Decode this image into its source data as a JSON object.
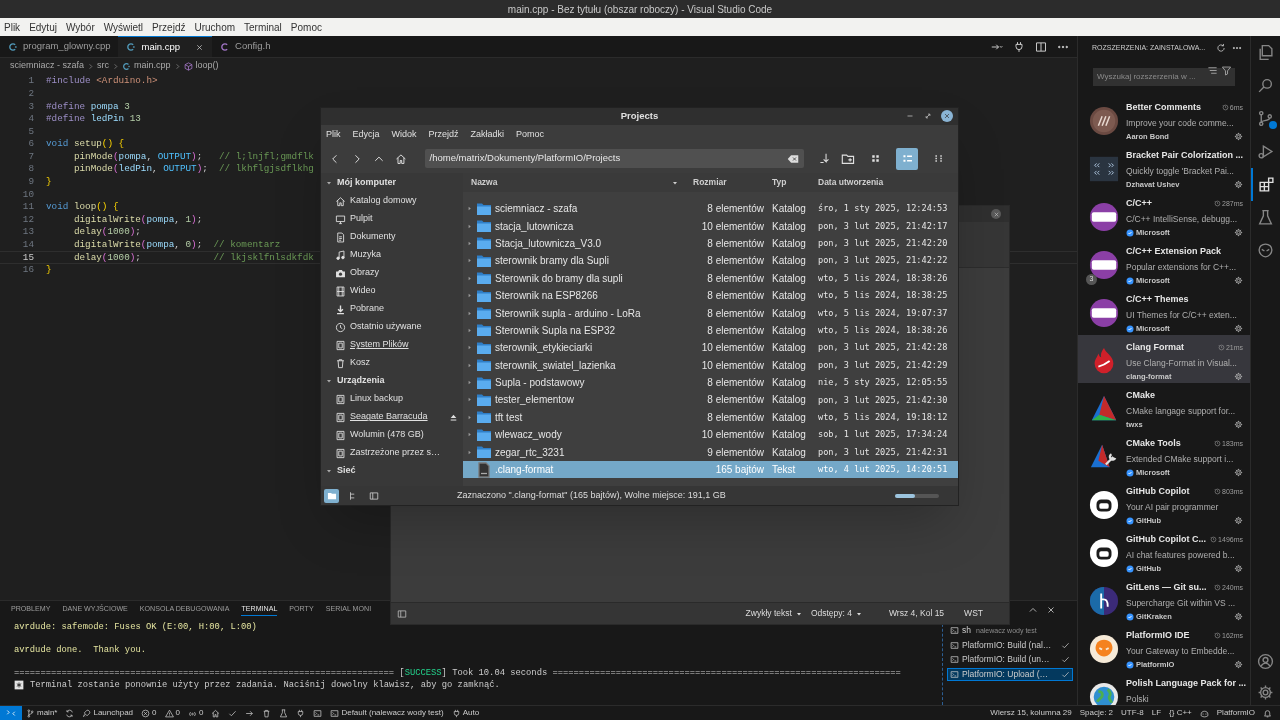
{
  "window": {
    "title": "main.cpp - Bez tytułu (obszar roboczy) - Visual Studio Code"
  },
  "menu": [
    "Plik",
    "Edytuj",
    "Wybór",
    "Wyświetl",
    "Przejdź",
    "Uruchom",
    "Terminal",
    "Pomoc"
  ],
  "editor": {
    "tabs": [
      {
        "label": "program_glowny.cpp",
        "kind": "cpp",
        "selected": false
      },
      {
        "label": "main.cpp",
        "kind": "cpp",
        "selected": true
      },
      {
        "label": "Config.h",
        "kind": "h",
        "selected": false
      }
    ],
    "breadcrumbs": [
      {
        "label": "sciemniacz - szafa",
        "kind": "folder"
      },
      {
        "label": "src",
        "kind": "folder"
      },
      {
        "label": "main.cpp",
        "kind": "cpp"
      },
      {
        "label": "loop()",
        "kind": "function"
      }
    ],
    "lines": [
      {
        "number": "1",
        "current": false,
        "tokens": [
          {
            "text": "#include ",
            "kind": "pre"
          },
          {
            "text": "<Arduino.h>",
            "kind": "str"
          }
        ]
      },
      {
        "number": "2",
        "current": false
      },
      {
        "number": "3",
        "current": false,
        "tokens": [
          {
            "text": "#define ",
            "kind": "pre"
          },
          {
            "text": "pompa",
            "kind": "macro"
          },
          {
            "text": " 3",
            "kind": "num"
          }
        ]
      },
      {
        "number": "4",
        "current": false,
        "tokens": [
          {
            "text": "#define ",
            "kind": "pre"
          },
          {
            "text": "ledPin",
            "kind": "macro"
          },
          {
            "text": " 13",
            "kind": "num"
          }
        ]
      },
      {
        "number": "5",
        "current": false
      },
      {
        "number": "6",
        "current": false,
        "tokens": [
          {
            "text": "void",
            "kind": "kw"
          },
          {
            "text": " setup",
            "kind": "fn"
          },
          {
            "text": "() {",
            "kind": "br1"
          }
        ]
      },
      {
        "number": "7",
        "current": false,
        "tokens": [
          {
            "text": "     pinMode",
            "kind": "fn"
          },
          {
            "text": "(",
            "kind": "br2"
          },
          {
            "text": "pompa",
            "kind": "var"
          },
          {
            "text": ", ",
            "kind": "plain"
          },
          {
            "text": "OUTPUT",
            "kind": "const"
          },
          {
            "text": ")",
            "kind": "br2"
          },
          {
            "text": ";   ",
            "kind": "plain"
          },
          {
            "text": "// l;lnjfl;gmdflk",
            "kind": "cmt"
          }
        ]
      },
      {
        "number": "8",
        "current": false,
        "tokens": [
          {
            "text": "     pinMode",
            "kind": "fn"
          },
          {
            "text": "(",
            "kind": "br2"
          },
          {
            "text": "ledPin",
            "kind": "var"
          },
          {
            "text": ", ",
            "kind": "plain"
          },
          {
            "text": "OUTPUT",
            "kind": "const"
          },
          {
            "text": ")",
            "kind": "br2"
          },
          {
            "text": ";  ",
            "kind": "plain"
          },
          {
            "text": "// lkhflgjsdflkhg",
            "kind": "cmt"
          }
        ]
      },
      {
        "number": "9",
        "current": false,
        "tokens": [
          {
            "text": "}",
            "kind": "br1"
          }
        ]
      },
      {
        "number": "10",
        "current": false
      },
      {
        "number": "11",
        "current": false,
        "tokens": [
          {
            "text": "void",
            "kind": "kw"
          },
          {
            "text": " loop",
            "kind": "fn"
          },
          {
            "text": "() {",
            "kind": "br1"
          }
        ]
      },
      {
        "number": "12",
        "current": false,
        "tokens": [
          {
            "text": "     digitalWrite",
            "kind": "fn"
          },
          {
            "text": "(",
            "kind": "br2"
          },
          {
            "text": "pompa",
            "kind": "var"
          },
          {
            "text": ", ",
            "kind": "plain"
          },
          {
            "text": "1",
            "kind": "num"
          },
          {
            "text": ")",
            "kind": "br2"
          },
          {
            "text": ";",
            "kind": "plain"
          }
        ]
      },
      {
        "number": "13",
        "current": false,
        "tokens": [
          {
            "text": "     delay",
            "kind": "fn"
          },
          {
            "text": "(",
            "kind": "br2"
          },
          {
            "text": "1000",
            "kind": "num"
          },
          {
            "text": ")",
            "kind": "br2"
          },
          {
            "text": ";",
            "kind": "plain"
          }
        ]
      },
      {
        "number": "14",
        "current": false,
        "tokens": [
          {
            "text": "     digitalWrite",
            "kind": "fn"
          },
          {
            "text": "(",
            "kind": "br2"
          },
          {
            "text": "pompa",
            "kind": "var"
          },
          {
            "text": ", ",
            "kind": "plain"
          },
          {
            "text": "0",
            "kind": "num"
          },
          {
            "text": ")",
            "kind": "br2"
          },
          {
            "text": ";  ",
            "kind": "plain"
          },
          {
            "text": "// komentarz",
            "kind": "cmt"
          }
        ]
      },
      {
        "number": "15",
        "current": true,
        "tokens": [
          {
            "text": "     delay",
            "kind": "fn"
          },
          {
            "text": "(",
            "kind": "br2"
          },
          {
            "text": "1000",
            "kind": "num"
          },
          {
            "text": ")",
            "kind": "br2"
          },
          {
            "text": ";             ",
            "kind": "plain"
          },
          {
            "text": "// lkjsklfnlsdkfdk",
            "kind": "cmt"
          }
        ]
      },
      {
        "number": "16",
        "current": false,
        "tokens": [
          {
            "text": "}",
            "kind": "br1"
          }
        ]
      }
    ]
  },
  "panel": {
    "tabs": [
      {
        "label": "PROBLEMY",
        "selected": false
      },
      {
        "label": "DANE WYJŚCIOWE",
        "selected": false
      },
      {
        "label": "KONSOLA DEBUGOWANIA",
        "selected": false
      },
      {
        "label": "TERMINAL",
        "selected": true
      },
      {
        "label": "PORTY",
        "selected": false
      },
      {
        "label": "SERIAL MONI",
        "selected": false
      }
    ],
    "terminal": [
      {
        "kind": "text",
        "tokens": [
          {
            "text": "avrdude: safemode: Fuses OK (E:00, H:00, L:00)",
            "kind": "warn"
          }
        ]
      },
      {
        "kind": "blank"
      },
      {
        "kind": "text",
        "tokens": [
          {
            "text": "avrdude done.  Thank you.",
            "kind": "warn"
          }
        ]
      },
      {
        "kind": "blank"
      },
      {
        "kind": "text",
        "tokens": [
          {
            "text": "======================================================================== [",
            "kind": "plain"
          },
          {
            "text": "SUCCESS",
            "kind": "success"
          },
          {
            "text": "] Took 10.04 seconds ==================================================================",
            "kind": "plain"
          }
        ]
      },
      {
        "kind": "notice",
        "tokens": [
          {
            "text": "Terminal zostanie ponownie użyty przez zadania. Naciśnij dowolny klawisz, aby go zamknąć.",
            "kind": "plain"
          }
        ]
      }
    ],
    "tasks": [
      {
        "kind": "shell",
        "label": "sh",
        "detail": "nalewacz wody test",
        "done": false,
        "selected": false
      },
      {
        "kind": "task",
        "label": "PlatformIO: Build (nal…",
        "done": true,
        "selected": false
      },
      {
        "kind": "task",
        "label": "PlatformIO: Build (un…",
        "done": true,
        "selected": false
      },
      {
        "kind": "task",
        "label": "PlatformIO: Upload (…",
        "done": true,
        "selected": true
      }
    ]
  },
  "text_editor_window": {
    "language": "Zwykły tekst",
    "indentation": "Odstępy: 4",
    "position": "Wrsz 4, Kol 15",
    "mode": "WST"
  },
  "file_manager": {
    "title": "Projects",
    "menu": [
      "Plik",
      "Edycja",
      "Widok",
      "Przejdź",
      "Zakładki",
      "Pomoc"
    ],
    "path": "/home/matrix/Dokumenty/PlatformIO/Projects",
    "views": [
      {
        "kind": "icons",
        "selected": false
      },
      {
        "kind": "list",
        "selected": true
      },
      {
        "kind": "compact",
        "selected": false
      }
    ],
    "sidebar": [
      {
        "label": "Mój komputer",
        "expanded": true,
        "items": [
          {
            "label": "Katalog domowy",
            "kind": "home",
            "underlined": false,
            "ejectable": false
          },
          {
            "label": "Pulpit",
            "kind": "desktop",
            "underlined": false,
            "ejectable": false
          },
          {
            "label": "Dokumenty",
            "kind": "documents",
            "underlined": false,
            "ejectable": false
          },
          {
            "label": "Muzyka",
            "kind": "music",
            "underlined": false,
            "ejectable": false
          },
          {
            "label": "Obrazy",
            "kind": "pictures",
            "underlined": false,
            "ejectable": false
          },
          {
            "label": "Wideo",
            "kind": "video",
            "underlined": false,
            "ejectable": false
          },
          {
            "label": "Pobrane",
            "kind": "downloads",
            "underlined": false,
            "ejectable": false
          },
          {
            "label": "Ostatnio używane",
            "kind": "recent",
            "underlined": false,
            "ejectable": false
          },
          {
            "label": "System Plików",
            "kind": "drive",
            "underlined": true,
            "ejectable": false
          },
          {
            "label": "Kosz",
            "kind": "trash",
            "underlined": false,
            "ejectable": false
          }
        ]
      },
      {
        "label": "Urządzenia",
        "expanded": true,
        "items": [
          {
            "label": "Linux backup",
            "kind": "drive",
            "underlined": false,
            "ejectable": false
          },
          {
            "label": "Seagate Barracuda",
            "kind": "drive",
            "underlined": true,
            "ejectable": true
          },
          {
            "label": "Wolumin (478 GB)",
            "kind": "drive",
            "underlined": false,
            "ejectable": false
          },
          {
            "label": "Zastrzeżone przez s…",
            "kind": "drive",
            "underlined": false,
            "ejectable": false
          }
        ]
      },
      {
        "label": "Sieć",
        "expanded": true
      }
    ],
    "columns": [
      {
        "label": "Nazwa",
        "sorted": true
      },
      {
        "label": "Rozmiar",
        "sorted": false
      },
      {
        "label": "Typ",
        "sorted": false
      },
      {
        "label": "Data utworzenia",
        "sorted": false
      }
    ],
    "rows": [
      {
        "kind": "folder",
        "name": "sciemniacz - szafa",
        "size": "8 elementów",
        "type": "Katalog",
        "date": "śro, 1 sty 2025, 12:24:53",
        "selected": false
      },
      {
        "kind": "folder",
        "name": "stacja_lutownicza",
        "size": "10 elementów",
        "type": "Katalog",
        "date": "pon, 3 lut 2025, 21:42:17",
        "selected": false
      },
      {
        "kind": "folder",
        "name": "Stacja_lutownicza_V3.0",
        "size": "8 elementów",
        "type": "Katalog",
        "date": "pon, 3 lut 2025, 21:42:20",
        "selected": false
      },
      {
        "kind": "folder",
        "name": "sterownik bramy dla Supli",
        "size": "8 elementów",
        "type": "Katalog",
        "date": "pon, 3 lut 2025, 21:42:22",
        "selected": false
      },
      {
        "kind": "folder",
        "name": "Sterownik do bramy dla supli",
        "size": "8 elementów",
        "type": "Katalog",
        "date": "wto, 5 lis 2024, 18:38:26",
        "selected": false
      },
      {
        "kind": "folder",
        "name": "Sterownik na ESP8266",
        "size": "8 elementów",
        "type": "Katalog",
        "date": "wto, 5 lis 2024, 18:38:25",
        "selected": false
      },
      {
        "kind": "folder",
        "name": "Sterownik supla - arduino - LoRa",
        "size": "8 elementów",
        "type": "Katalog",
        "date": "wto, 5 lis 2024, 19:07:37",
        "selected": false
      },
      {
        "kind": "folder",
        "name": "Sterownik Supla na ESP32",
        "size": "8 elementów",
        "type": "Katalog",
        "date": "wto, 5 lis 2024, 18:38:26",
        "selected": false
      },
      {
        "kind": "folder",
        "name": "sterownik_etykieciarki",
        "size": "10 elementów",
        "type": "Katalog",
        "date": "pon, 3 lut 2025, 21:42:28",
        "selected": false
      },
      {
        "kind": "folder",
        "name": "sterownik_swiatel_lazienka",
        "size": "10 elementów",
        "type": "Katalog",
        "date": "pon, 3 lut 2025, 21:42:29",
        "selected": false
      },
      {
        "kind": "folder",
        "name": "Supla - podstawowy",
        "size": "8 elementów",
        "type": "Katalog",
        "date": "nie, 5 sty 2025, 12:05:55",
        "selected": false
      },
      {
        "kind": "folder",
        "name": "tester_elementow",
        "size": "8 elementów",
        "type": "Katalog",
        "date": "pon, 3 lut 2025, 21:42:30",
        "selected": false
      },
      {
        "kind": "folder",
        "name": "tft test",
        "size": "8 elementów",
        "type": "Katalog",
        "date": "wto, 5 lis 2024, 19:18:12",
        "selected": false
      },
      {
        "kind": "folder",
        "name": "wlewacz_wody",
        "size": "10 elementów",
        "type": "Katalog",
        "date": "sob, 1 lut 2025, 17:34:24",
        "selected": false
      },
      {
        "kind": "folder",
        "name": "zegar_rtc_3231",
        "size": "9 elementów",
        "type": "Katalog",
        "date": "pon, 3 lut 2025, 21:42:31",
        "selected": false
      },
      {
        "kind": "file",
        "name": ".clang-format",
        "size": "165 bajtów",
        "type": "Tekst",
        "date": "wto, 4 lut 2025, 14:20:51",
        "selected": true
      }
    ],
    "pane_buttons": [
      {
        "kind": "places",
        "selected": true
      },
      {
        "kind": "tree",
        "selected": false
      },
      {
        "kind": "toggle",
        "selected": false
      }
    ],
    "status": "Zaznaczono \".clang-format\" (165 bajtów), Wolne miejsce: 191,1 GB",
    "zoom": {
      "level": 0.45
    }
  },
  "extensions": {
    "header": "ROZSZERZENIA: ZAINSTALOWA...",
    "search_placeholder": "Wyszukaj rozszerzenia w ...",
    "items": [
      {
        "kind": "comments",
        "name": "Better Comments",
        "time": "6ms",
        "description": "Improve your code comme...",
        "publisher": "Aaron Bond",
        "verified": false,
        "selected": false
      },
      {
        "kind": "brackets",
        "name": "Bracket Pair Colorization ...",
        "description": "Quickly toggle 'Bracket Pai...",
        "publisher": "Dzhavat Ushev",
        "verified": false,
        "selected": false
      },
      {
        "kind": "cpp",
        "name": "C/C++",
        "time": "287ms",
        "description": "C/C++ IntelliSense, debugg...",
        "publisher": "Microsoft",
        "verified": true,
        "selected": false
      },
      {
        "kind": "cpp",
        "name": "C/C++ Extension Pack",
        "description": "Popular extensions for C++...",
        "publisher": "Microsoft",
        "verified": true,
        "selected": false,
        "badge": "3"
      },
      {
        "kind": "cpp",
        "name": "C/C++ Themes",
        "description": "UI Themes for C/C++ exten...",
        "publisher": "Microsoft",
        "verified": true,
        "selected": false
      },
      {
        "kind": "flame",
        "name": "Clang Format",
        "time": "21ms",
        "description": "Use Clang-Format in Visual...",
        "publisher": "clang-format",
        "verified": false,
        "selected": true
      },
      {
        "kind": "triangle",
        "name": "CMake",
        "description": "CMake langage support for...",
        "publisher": "twxs",
        "verified": false,
        "selected": false
      },
      {
        "kind": "triangle-wrench",
        "name": "CMake Tools",
        "time": "183ms",
        "description": "Extended CMake support i...",
        "publisher": "Microsoft",
        "verified": true,
        "selected": false
      },
      {
        "kind": "robot",
        "name": "GitHub Copilot",
        "time": "803ms",
        "description": "Your AI pair programmer",
        "publisher": "GitHub",
        "verified": true,
        "selected": false
      },
      {
        "kind": "robot",
        "name": "GitHub Copilot C...",
        "time": "1496ms",
        "description": "AI chat features powered b...",
        "publisher": "GitHub",
        "verified": true,
        "selected": false
      },
      {
        "kind": "branch",
        "name": "GitLens — Git su...",
        "time": "240ms",
        "description": "Supercharge Git within VS ...",
        "publisher": "GitKraken",
        "verified": true,
        "selected": false
      },
      {
        "kind": "alien",
        "name": "PlatformIO IDE",
        "time": "162ms",
        "description": "Your Gateway to Embedde...",
        "publisher": "PlatformIO",
        "verified": true,
        "selected": false
      },
      {
        "kind": "globe",
        "name": "Polish Language Pack for ...",
        "description": "Polski",
        "selected": false
      }
    ]
  },
  "activity_bar": [
    {
      "kind": "files",
      "selected": false
    },
    {
      "kind": "search",
      "selected": false
    },
    {
      "kind": "scm",
      "selected": false
    },
    {
      "kind": "run",
      "selected": false
    },
    {
      "kind": "extensions",
      "selected": true
    },
    {
      "kind": "testing",
      "selected": false
    },
    {
      "kind": "alien",
      "selected": false
    }
  ],
  "status_bar": {
    "left": [
      {
        "kind": "remote"
      },
      {
        "kind": "branch",
        "text": "main*"
      },
      {
        "kind": "sync"
      },
      {
        "kind": "rocket",
        "text": "Launchpad"
      },
      {
        "kind": "error",
        "text": "0"
      },
      {
        "kind": "warning",
        "text": "0"
      },
      {
        "kind": "broadcast",
        "text": "0"
      },
      {
        "kind": "home"
      },
      {
        "kind": "check"
      },
      {
        "kind": "arrow"
      },
      {
        "kind": "trash"
      },
      {
        "kind": "flask"
      },
      {
        "kind": "plug"
      },
      {
        "kind": "terminal"
      },
      {
        "kind": "terminal",
        "text": "Default (nalewacz wody test)"
      },
      {
        "kind": "plug",
        "text": "Auto"
      }
    ],
    "right": [
      {
        "kind": "text",
        "text": "Wiersz 15, kolumna 29"
      },
      {
        "kind": "text",
        "text": "Spacje: 2"
      },
      {
        "kind": "text",
        "text": "UTF-8"
      },
      {
        "kind": "text",
        "text": "LF"
      },
      {
        "kind": "text",
        "text": "{} C++"
      },
      {
        "kind": "robot"
      },
      {
        "kind": "text",
        "text": "PlatformIO"
      },
      {
        "kind": "bell"
      }
    ]
  }
}
